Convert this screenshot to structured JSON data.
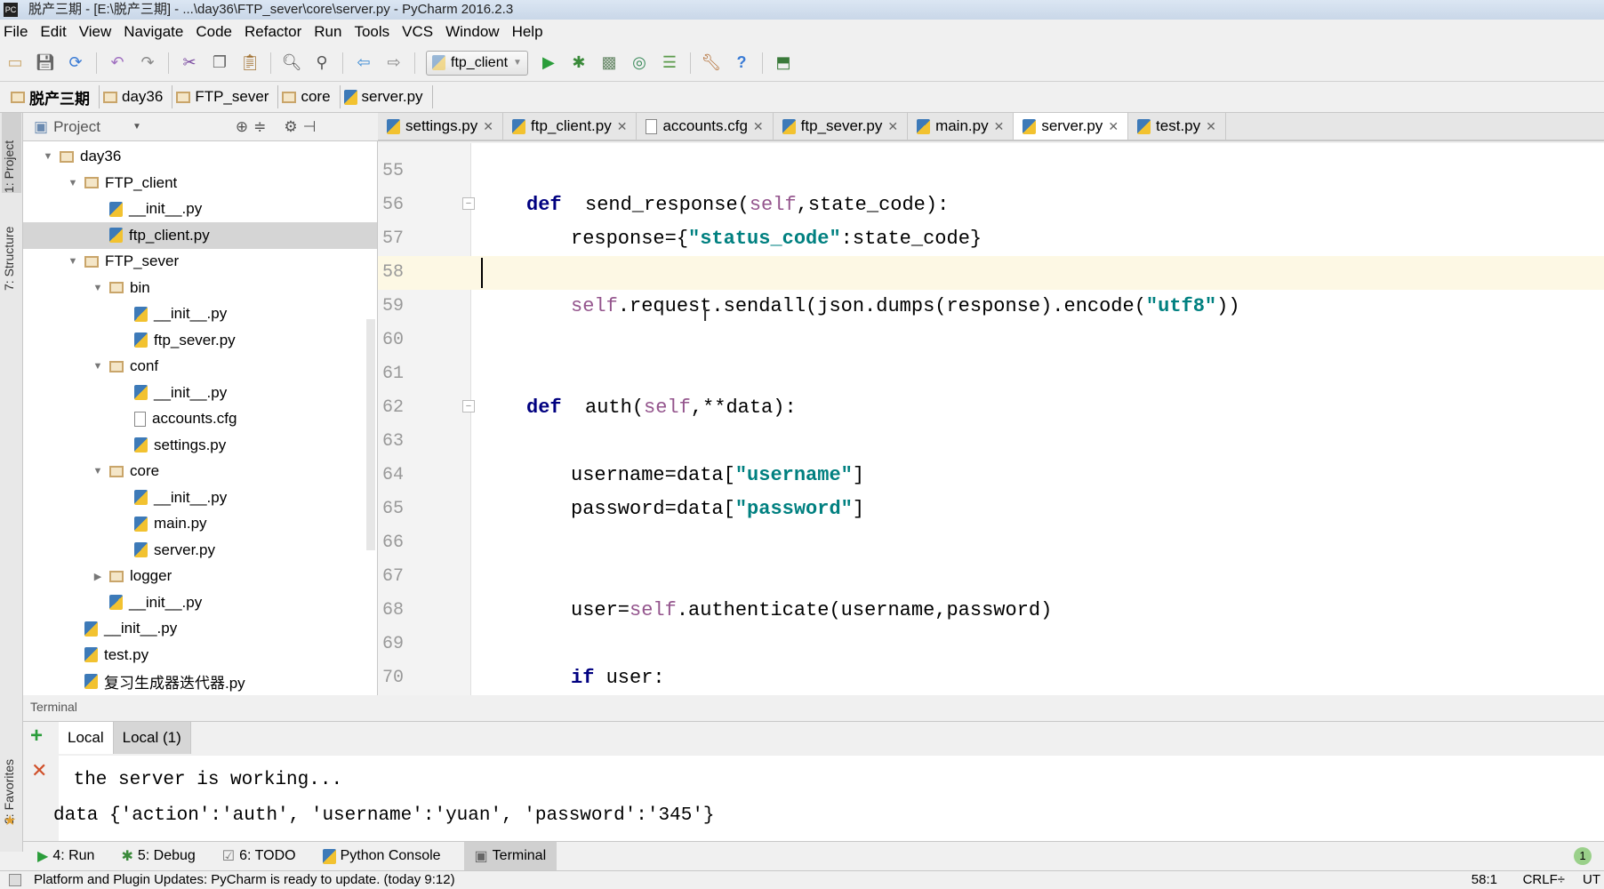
{
  "window": {
    "title": "脱产三期 - [E:\\脱产三期] - ...\\day36\\FTP_sever\\core\\server.py - PyCharm 2016.2.3"
  },
  "menu": [
    "File",
    "Edit",
    "View",
    "Navigate",
    "Code",
    "Refactor",
    "Run",
    "Tools",
    "VCS",
    "Window",
    "Help"
  ],
  "toolbar": {
    "run_config": "ftp_client"
  },
  "breadcrumb": [
    "脱产三期",
    "day36",
    "FTP_sever",
    "core",
    "server.py"
  ],
  "side_tabs": {
    "project": "1: Project",
    "structure": "7: Structure",
    "favorites": "2: Favorites"
  },
  "project_panel": {
    "title": "Project"
  },
  "tree": [
    {
      "label": "day36",
      "type": "folder",
      "level": 0,
      "expanded": true
    },
    {
      "label": "FTP_client",
      "type": "folder",
      "level": 1,
      "expanded": true
    },
    {
      "label": "__init__.py",
      "type": "py",
      "level": 2
    },
    {
      "label": "ftp_client.py",
      "type": "py",
      "level": 2,
      "selected": true
    },
    {
      "label": "FTP_sever",
      "type": "folder",
      "level": 1,
      "expanded": true
    },
    {
      "label": "bin",
      "type": "folder",
      "level": 2,
      "expanded": true
    },
    {
      "label": "__init__.py",
      "type": "py",
      "level": 3
    },
    {
      "label": "ftp_sever.py",
      "type": "py",
      "level": 3
    },
    {
      "label": "conf",
      "type": "folder",
      "level": 2,
      "expanded": true
    },
    {
      "label": "__init__.py",
      "type": "py",
      "level": 3
    },
    {
      "label": "accounts.cfg",
      "type": "cfg",
      "level": 3
    },
    {
      "label": "settings.py",
      "type": "py",
      "level": 3
    },
    {
      "label": "core",
      "type": "folder",
      "level": 2,
      "expanded": true
    },
    {
      "label": "__init__.py",
      "type": "py",
      "level": 3
    },
    {
      "label": "main.py",
      "type": "py",
      "level": 3
    },
    {
      "label": "server.py",
      "type": "py",
      "level": 3
    },
    {
      "label": "logger",
      "type": "folder",
      "level": 2,
      "expanded": false
    },
    {
      "label": "__init__.py",
      "type": "py",
      "level": 2
    },
    {
      "label": "__init__.py",
      "type": "py",
      "level": 1
    },
    {
      "label": "test.py",
      "type": "py",
      "level": 1
    },
    {
      "label": "复习生成器迭代器.py",
      "type": "py",
      "level": 1
    }
  ],
  "editor_tabs": [
    {
      "label": "settings.py",
      "type": "py"
    },
    {
      "label": "ftp_client.py",
      "type": "py"
    },
    {
      "label": "accounts.cfg",
      "type": "cfg"
    },
    {
      "label": "ftp_sever.py",
      "type": "py"
    },
    {
      "label": "main.py",
      "type": "py"
    },
    {
      "label": "server.py",
      "type": "py",
      "active": true
    },
    {
      "label": "test.py",
      "type": "py"
    }
  ],
  "code": [
    {
      "n": "55",
      "tokens": []
    },
    {
      "n": "56",
      "indent": 0,
      "tokens": [
        [
          "kw",
          "def"
        ],
        [
          "",
          "  send_response("
        ],
        [
          "self",
          "self"
        ],
        [
          "",
          ",state_code):"
        ]
      ]
    },
    {
      "n": "57",
      "indent": 1,
      "tokens": [
        [
          "",
          "response={"
        ],
        [
          "str",
          "\"status_code\""
        ],
        [
          "",
          ":state_code}"
        ]
      ]
    },
    {
      "n": "58",
      "tokens": [],
      "current": true
    },
    {
      "n": "59",
      "indent": 1,
      "tokens": [
        [
          "self",
          "self"
        ],
        [
          "",
          ".request.sendall(json.dumps(response).encode("
        ],
        [
          "str",
          "\"utf8\""
        ],
        [
          "",
          "))"
        ]
      ]
    },
    {
      "n": "60",
      "tokens": []
    },
    {
      "n": "61",
      "tokens": []
    },
    {
      "n": "62",
      "indent": 0,
      "tokens": [
        [
          "kw",
          "def"
        ],
        [
          "",
          "  auth("
        ],
        [
          "self",
          "self"
        ],
        [
          "",
          ",**data):"
        ]
      ]
    },
    {
      "n": "63",
      "tokens": []
    },
    {
      "n": "64",
      "indent": 1,
      "tokens": [
        [
          "",
          "username=data["
        ],
        [
          "str",
          "\"username\""
        ],
        [
          "",
          "]"
        ]
      ]
    },
    {
      "n": "65",
      "indent": 1,
      "tokens": [
        [
          "",
          "password=data["
        ],
        [
          "str",
          "\"password\""
        ],
        [
          "",
          "]"
        ]
      ]
    },
    {
      "n": "66",
      "tokens": []
    },
    {
      "n": "67",
      "tokens": []
    },
    {
      "n": "68",
      "indent": 1,
      "tokens": [
        [
          "",
          "user="
        ],
        [
          "self",
          "self"
        ],
        [
          "",
          ".authenticate(username,password)"
        ]
      ]
    },
    {
      "n": "69",
      "tokens": []
    },
    {
      "n": "70",
      "indent": 1,
      "tokens": [
        [
          "kw",
          "if"
        ],
        [
          "",
          " user:"
        ]
      ]
    }
  ],
  "terminal": {
    "title": "Terminal",
    "tabs": [
      "Local",
      "Local (1)"
    ],
    "lines": [
      " the server is working...",
      "data {'action':'auth', 'username':'yuan', 'password':'345'}"
    ]
  },
  "bottom_tabs": [
    "4: Run",
    "5: Debug",
    "6: TODO",
    "Python Console",
    "Terminal"
  ],
  "status": {
    "message": "Platform and Plugin Updates: PyCharm is ready to update. (today 9:12)",
    "position": "58:1",
    "line_sep": "CRLF÷",
    "encoding": "UT",
    "event_count": "1"
  }
}
